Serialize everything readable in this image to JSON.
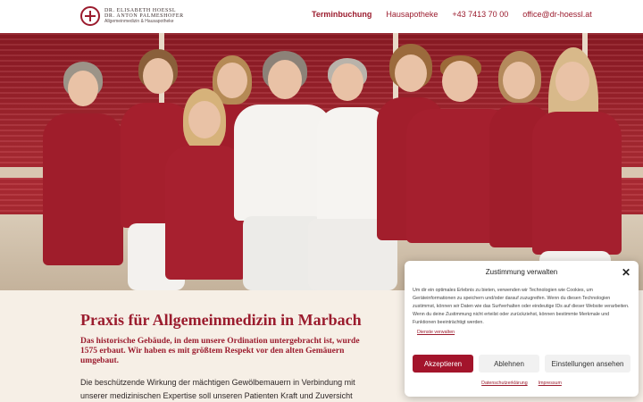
{
  "header": {
    "logo": {
      "line1": "DR. ELISABETH HOESSL",
      "line2": "DR. ANTON PALMESHOFER",
      "line3": "Allgemeinmedizin & Hausapotheke"
    },
    "nav": {
      "termin": "Terminbuchung",
      "apotheke": "Hausapotheke",
      "phone": "+43 7413 70 00",
      "email": "office@dr-hoessl.at"
    }
  },
  "hero": {
    "image_alt": "Team photo of the practice staff in red and white uniforms"
  },
  "main": {
    "title": "Praxis für Allgemeinmedizin in Marbach",
    "lead": "Das historische Gebäude, in dem unsere Ordination untergebracht ist, wurde 1575 erbaut. Wir haben es mit größtem Respekt vor den alten Gemäuern umgebaut.",
    "body": "Die beschützende Wirkung der mächtigen Gewölbemauern in Verbindung mit unserer medizinischen Expertise soll unseren Patienten Kraft und Zuversicht vermitteln, dass wir ihre Probleme rasch lindern oder heilen können."
  },
  "consent": {
    "title": "Zustimmung verwalten",
    "close_icon": "close-icon",
    "text": "Um dir ein optimales Erlebnis zu bieten, verwenden wir Technologien wie Cookies, um Geräteinformationen zu speichern und/oder darauf zuzugreifen. Wenn du diesen Technologien zustimmst, können wir Daten wie das Surfverhalten oder eindeutige IDs auf dieser Website verarbeiten. Wenn du deine Zustimmung nicht erteilst oder zurückziehst, können bestimmte Merkmale und Funktionen beeinträchtigt werden.",
    "services_link": "Dienste verwalten",
    "accept": "Akzeptieren",
    "deny": "Ablehnen",
    "settings": "Einstellungen ansehen",
    "privacy": "Datenschutzerklärung",
    "imprint": "Impressum"
  },
  "colors": {
    "brand": "#9b1c2e",
    "accept_button": "#a3142b",
    "background": "#f6efe6"
  }
}
